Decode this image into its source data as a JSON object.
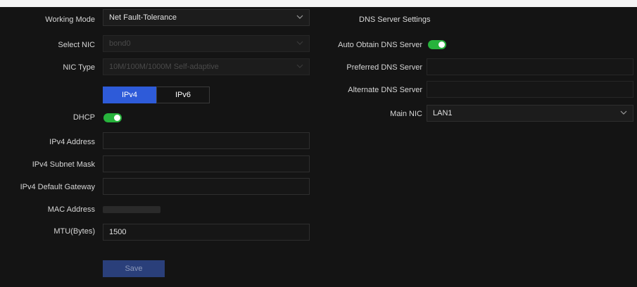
{
  "left": {
    "working_mode": {
      "label": "Working Mode",
      "value": "Net Fault-Tolerance"
    },
    "select_nic": {
      "label": "Select NIC",
      "value": "bond0"
    },
    "nic_type": {
      "label": "NIC Type",
      "value": "10M/100M/1000M Self-adaptive"
    },
    "ip_tabs": [
      "IPv4",
      "IPv6"
    ],
    "dhcp": {
      "label": "DHCP",
      "enabled": true
    },
    "ipv4_address": {
      "label": "IPv4 Address",
      "value": ""
    },
    "ipv4_subnet_mask": {
      "label": "IPv4 Subnet Mask",
      "value": ""
    },
    "ipv4_default_gateway": {
      "label": "IPv4 Default Gateway",
      "value": ""
    },
    "mac_address": {
      "label": "MAC Address"
    },
    "mtu": {
      "label": "MTU(Bytes)",
      "value": "1500"
    },
    "save_label": "Save"
  },
  "right": {
    "heading": "DNS Server Settings",
    "auto_dns": {
      "label": "Auto Obtain DNS Server",
      "enabled": true
    },
    "preferred_dns": {
      "label": "Preferred DNS Server",
      "value": ""
    },
    "alternate_dns": {
      "label": "Alternate DNS Server",
      "value": ""
    },
    "main_nic": {
      "label": "Main NIC",
      "value": "LAN1"
    }
  },
  "colors": {
    "accent": "#2e5bd9",
    "toggle_on": "#27b33c",
    "background": "#141414"
  }
}
